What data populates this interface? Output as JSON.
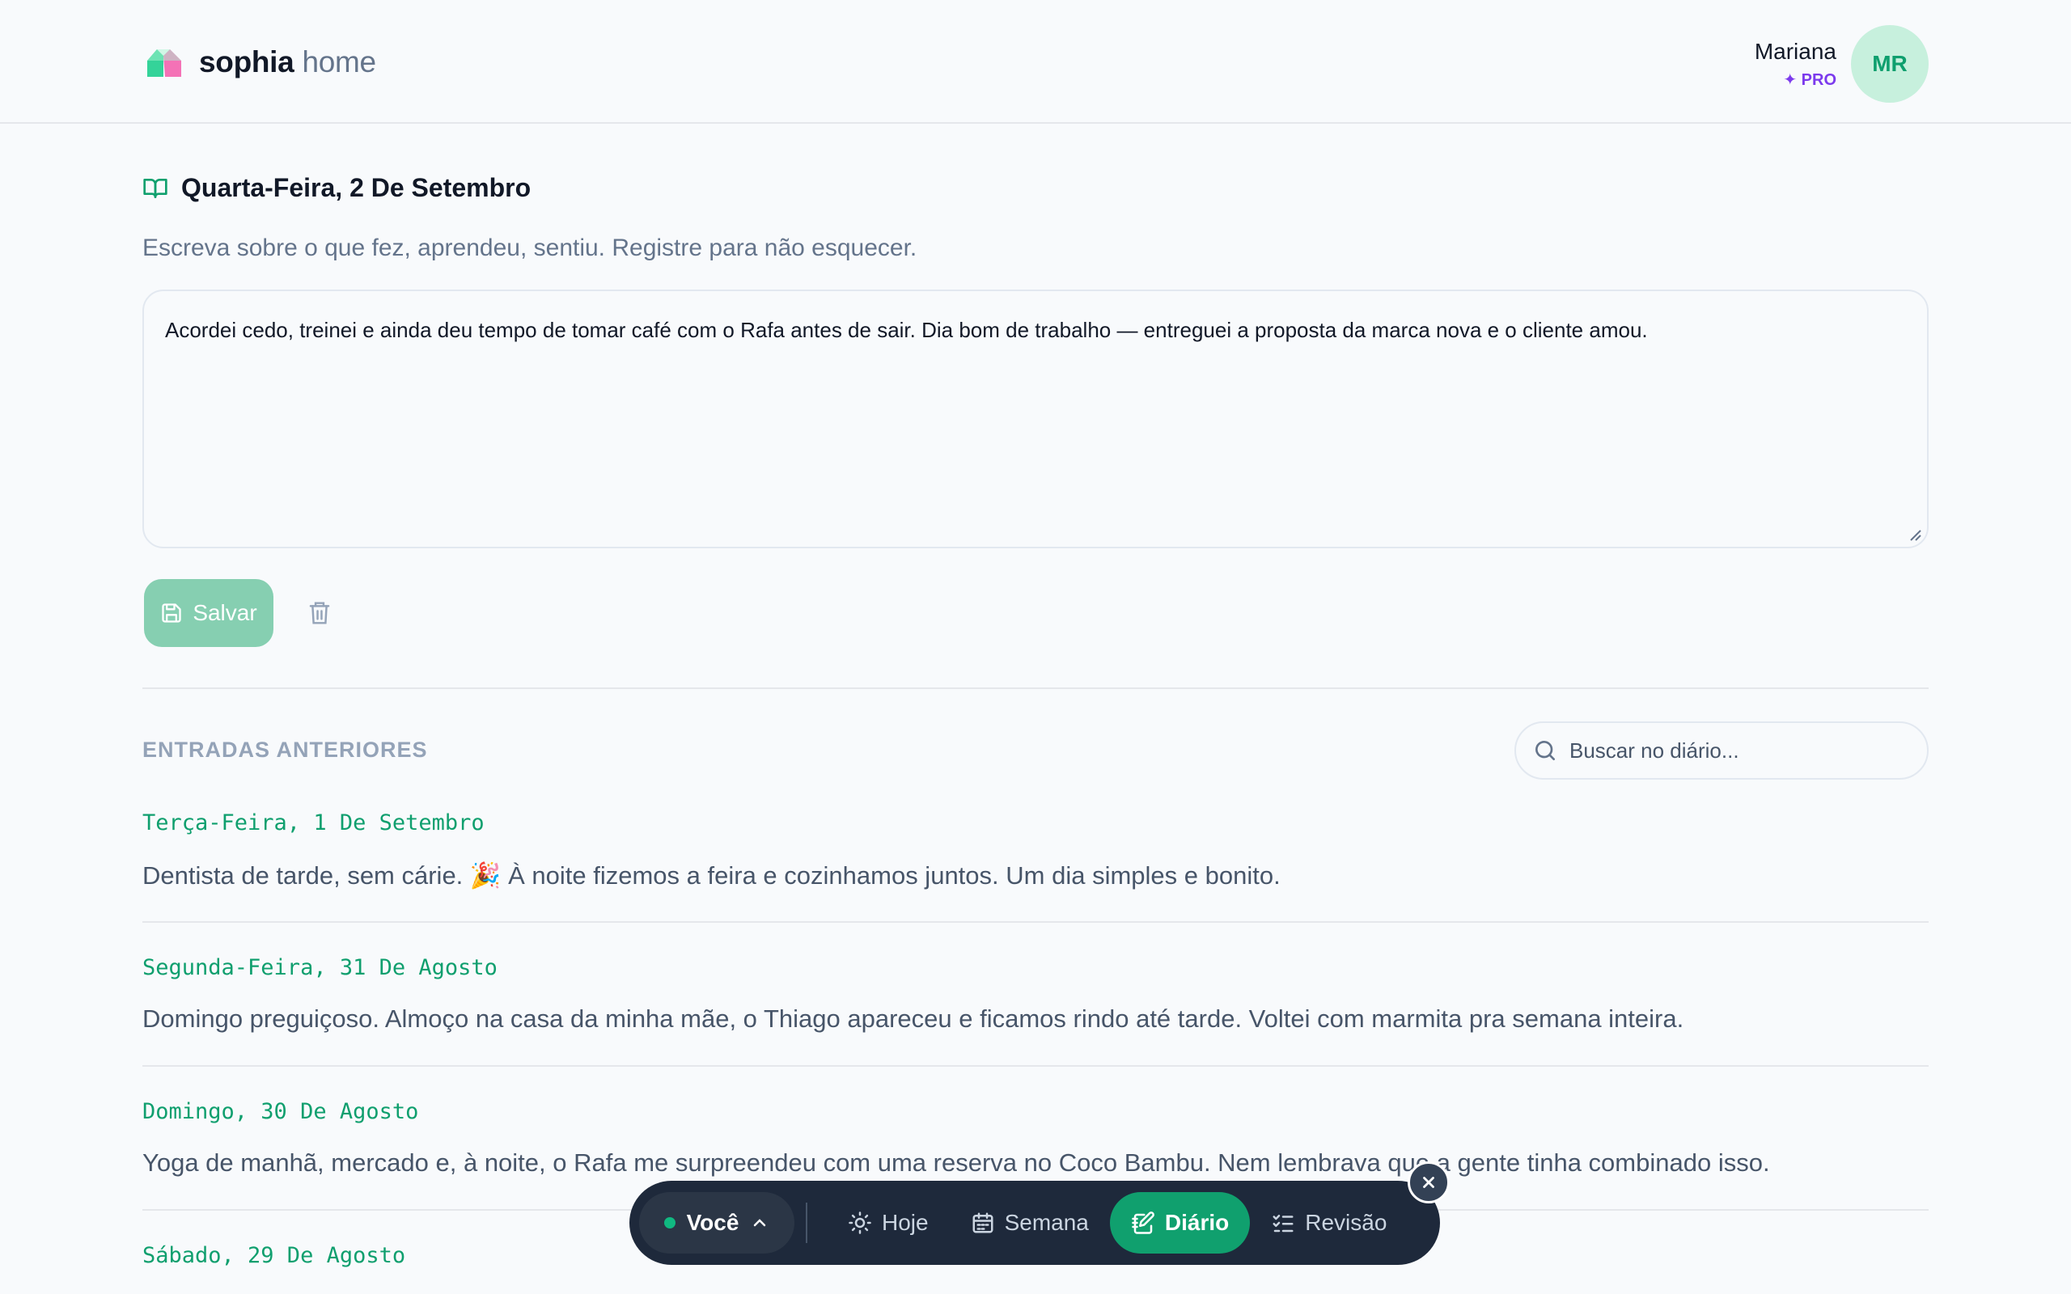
{
  "app": {
    "brand_bold": "sophia",
    "brand_light": "home"
  },
  "user": {
    "name": "Mariana",
    "badge": "✦ PRO",
    "initials": "MR"
  },
  "today": {
    "date": "Quarta-Feira, 2 De Setembro",
    "prompt": "Escreva sobre o que fez, aprendeu, sentiu. Registre para não esquecer.",
    "entry": "Acordei cedo, treinei e ainda deu tempo de tomar café com o Rafa antes de sair. Dia bom de trabalho — entreguei a proposta da marca nova e o cliente amou."
  },
  "actions": {
    "save_label": "Salvar"
  },
  "history": {
    "title": "ENTRADAS ANTERIORES",
    "search_placeholder": "Buscar no diário...",
    "entries": [
      {
        "date": "Terça-Feira, 1 De Setembro",
        "text": "Dentista de tarde, sem cárie. 🎉 À noite fizemos a feira e cozinhamos juntos. Um dia simples e bonito."
      },
      {
        "date": "Segunda-Feira, 31 De Agosto",
        "text": "Domingo preguiçoso. Almoço na casa da minha mãe, o Thiago apareceu e ficamos rindo até tarde. Voltei com marmita pra semana inteira."
      },
      {
        "date": "Domingo, 30 De Agosto",
        "text": "Yoga de manhã, mercado e, à noite, o Rafa me surpreendeu com uma reserva no Coco Bambu. Nem lembrava que a gente tinha combinado isso."
      },
      {
        "date": "Sábado, 29 De Agosto",
        "text": ""
      }
    ]
  },
  "nav": {
    "you": "Você",
    "items": [
      {
        "label": "Hoje",
        "icon": "sun-icon"
      },
      {
        "label": "Semana",
        "icon": "calendar-icon"
      },
      {
        "label": "Diário",
        "icon": "notebook-pen-icon"
      },
      {
        "label": "Revisão",
        "icon": "list-checks-icon"
      }
    ]
  },
  "colors": {
    "accent": "#10a06e",
    "pro": "#7c3aed",
    "nav_bg": "#1e293b"
  }
}
